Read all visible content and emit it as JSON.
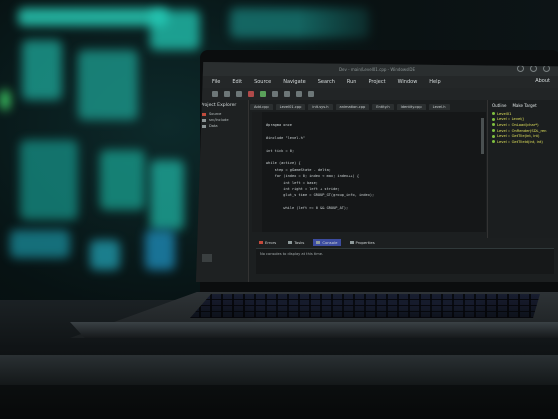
{
  "ide": {
    "title_text": "Dev - main/Level01.cpp - WindowsIDE",
    "menu": [
      "File",
      "Edit",
      "Source",
      "Navigate",
      "Search",
      "Run",
      "Project",
      "Window",
      "Help"
    ],
    "menu_right": "About",
    "left_panel": {
      "title": "Project Explorer",
      "items": [
        "Source",
        "src/Include",
        "Data"
      ]
    },
    "editor_tabs": [
      "Add.cpp",
      "Level01.cpp",
      "init.sys.h",
      "animation.cpp",
      "Entity.h",
      "Identity.cpp",
      "Level.h"
    ],
    "code_lines": [
      "#pragma once",
      "",
      "#include \"level.h\"",
      "",
      "int tick = 0;",
      "",
      "while (active) {",
      "    step = gGameState - delta;",
      "    for (index = 0; index < max; index++) {",
      "        int left = base;",
      "        int right = left + stride;",
      "        glut_s time = GROUP_GT(group_info, index);",
      "",
      "        while (left >= 0 && GROUP_AT);"
    ],
    "outline": {
      "tabs": [
        "Outline",
        "Make Target"
      ],
      "items": [
        "Level01",
        "Level :: Level()",
        "Level :: OnLoad(char*)",
        "Level :: OnRender(SDL_ren",
        "Level :: GetTile(int, int)",
        "Level :: GetTileId(int, int)"
      ]
    },
    "bottom_tabs": [
      "Errors",
      "Tasks",
      "Console",
      "Properties"
    ],
    "console_text": "No consoles to display at this time."
  },
  "colors": {
    "accent": "#3c4ca0",
    "outline_name": "#dfe05a",
    "error_red": "#c4493b",
    "status_green": "#7fbf3f"
  }
}
